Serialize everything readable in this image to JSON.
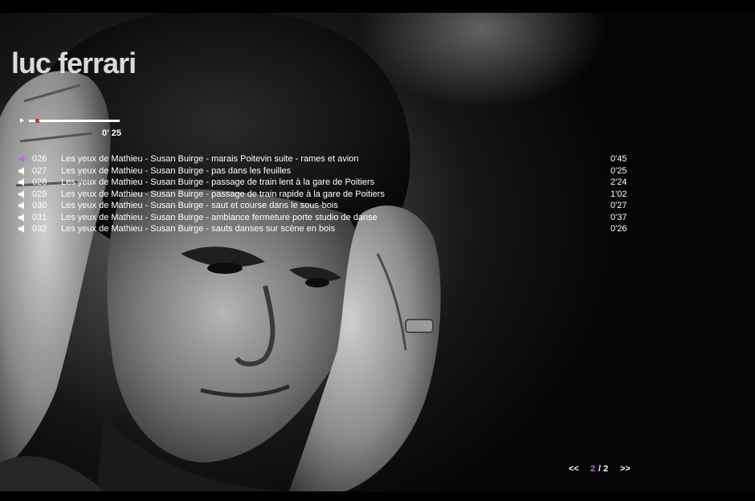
{
  "header": {
    "title": "luc ferrari"
  },
  "player": {
    "time": "0' 25",
    "progress": 0.09
  },
  "tracks": [
    {
      "number": "026",
      "title": "Les yeux de Mathieu - Susan Buirge - marais Poitevin suite - rames et avion",
      "duration": "0'45",
      "active": true
    },
    {
      "number": "027",
      "title": "Les yeux de Mathieu - Susan Buirge - pas dans les feuilles",
      "duration": "0'25",
      "active": false
    },
    {
      "number": "028",
      "title": "Les yeux de Mathieu - Susan Buirge - passage de train lent à la gare de Poitiers",
      "duration": "2'24",
      "active": false
    },
    {
      "number": "029",
      "title": "Les yeux de Mathieu - Susan Buirge - passage de train rapide à la gare de Poitiers",
      "duration": "1'02",
      "active": false
    },
    {
      "number": "030",
      "title": "Les yeux de Mathieu - Susan Buirge - saut et course dans le sous-bois",
      "duration": "0'27",
      "active": false
    },
    {
      "number": "031",
      "title": "Les yeux de Mathieu - Susan Buirge - ambiance fermeture porte studio de danse",
      "duration": "0'37",
      "active": false
    },
    {
      "number": "032",
      "title": "Les yeux de Mathieu - Susan Buirge - sauts danses sur scène en bois",
      "duration": "0'26",
      "active": false
    }
  ],
  "pagination": {
    "prev": "<<",
    "current": "2",
    "total": "/ 2",
    "next": ">>"
  },
  "colors": {
    "accent": "#c06bd6",
    "progress_knob": "#d23a3a",
    "text": "#ffffff",
    "background": "#000000"
  },
  "icons": {
    "track": "speaker-icon",
    "play": "play-icon"
  }
}
